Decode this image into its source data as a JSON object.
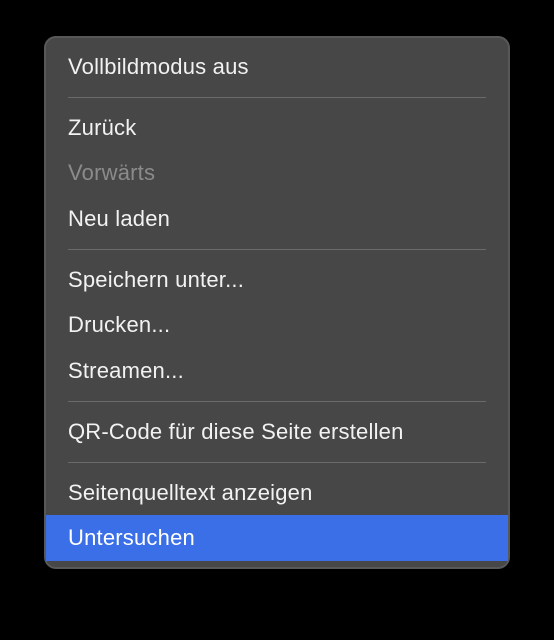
{
  "menu": {
    "groups": [
      [
        {
          "label": "Vollbildmodus aus",
          "disabled": false,
          "highlight": false
        }
      ],
      [
        {
          "label": "Zurück",
          "disabled": false,
          "highlight": false
        },
        {
          "label": "Vorwärts",
          "disabled": true,
          "highlight": false
        },
        {
          "label": "Neu laden",
          "disabled": false,
          "highlight": false
        }
      ],
      [
        {
          "label": "Speichern unter...",
          "disabled": false,
          "highlight": false
        },
        {
          "label": "Drucken...",
          "disabled": false,
          "highlight": false
        },
        {
          "label": "Streamen...",
          "disabled": false,
          "highlight": false
        }
      ],
      [
        {
          "label": "QR-Code für diese Seite erstellen",
          "disabled": false,
          "highlight": false
        }
      ],
      [
        {
          "label": "Seitenquelltext anzeigen",
          "disabled": false,
          "highlight": false
        },
        {
          "label": "Untersuchen",
          "disabled": false,
          "highlight": true
        }
      ]
    ]
  }
}
